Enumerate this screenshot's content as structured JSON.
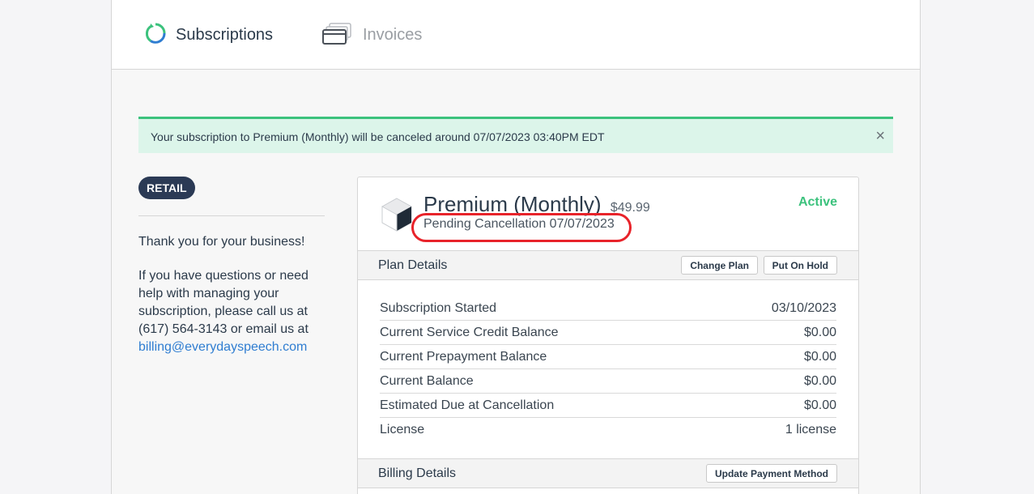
{
  "tabs": {
    "subscriptions": "Subscriptions",
    "invoices": "Invoices"
  },
  "alert": {
    "message": "Your subscription to Premium (Monthly) will be canceled around 07/07/2023 03:40PM EDT",
    "close": "×"
  },
  "sidebar": {
    "badge": "RETAIL",
    "thanks": "Thank you for your business!",
    "help": "If you have questions or need help with managing your subscription, please call us at (617) 564-3143 or email us at",
    "email": "billing@everydayspeech.com"
  },
  "plan": {
    "name": "Premium (Monthly)",
    "price": "$49.99",
    "pending": "Pending Cancellation 07/07/2023",
    "status": "Active"
  },
  "plan_details": {
    "title": "Plan Details",
    "change_plan": "Change Plan",
    "put_on_hold": "Put On Hold",
    "rows": [
      {
        "label": "Subscription Started",
        "value": "03/10/2023"
      },
      {
        "label": "Current Service Credit Balance",
        "value": "$0.00"
      },
      {
        "label": "Current Prepayment Balance",
        "value": "$0.00"
      },
      {
        "label": "Current Balance",
        "value": "$0.00"
      },
      {
        "label": "Estimated Due at Cancellation",
        "value": "$0.00"
      },
      {
        "label": "License",
        "value": "1 license"
      }
    ]
  },
  "billing_details": {
    "title": "Billing Details",
    "update_payment": "Update Payment Method"
  },
  "colors": {
    "accent_green": "#3cc27d",
    "badge_navy": "#2b3a55",
    "link_blue": "#2f7dd1",
    "highlight_red": "#e8232a"
  },
  "icons": {
    "subscriptions": "refresh-cycle-icon",
    "invoices": "invoice-cards-icon",
    "plan": "cube-icon",
    "close": "close-icon"
  }
}
